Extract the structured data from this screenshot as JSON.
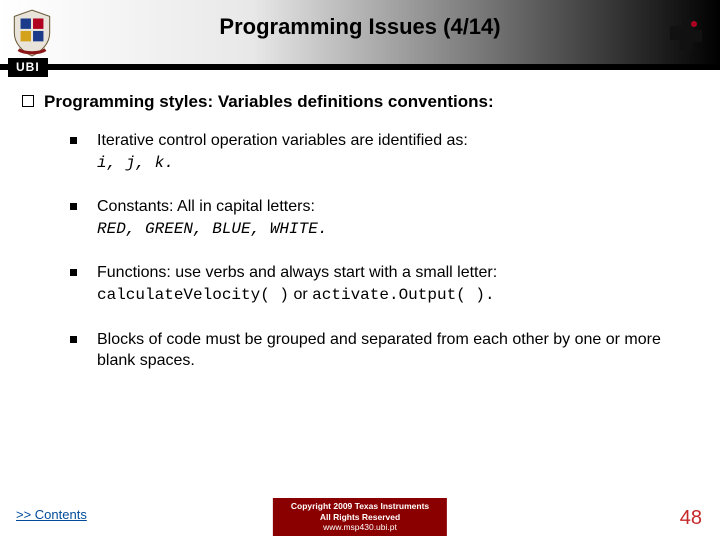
{
  "header": {
    "title": "Programming Issues (4/14)",
    "ubi_tag": "UBI"
  },
  "main": {
    "heading": "Programming styles: Variables definitions conventions:",
    "items": [
      {
        "lead": "Iterative control operation variables are identified as:",
        "mono": "i, j, k."
      },
      {
        "lead": "Constants: All in capital letters:",
        "mono": "RED, GREEN, BLUE, WHITE."
      },
      {
        "lead": "Functions: use verbs and always start with a small letter:",
        "mono_a": "calculateVelocity( )",
        "mid": " or ",
        "mono_b": "activate.Output( )."
      },
      {
        "lead": "Blocks of code must be grouped and separated from each other by one or more blank spaces."
      }
    ]
  },
  "footer": {
    "contents_link": ">> Contents",
    "copyright_line1": "Copyright 2009 Texas Instruments",
    "copyright_line2": "All Rights Reserved",
    "copyright_url": "www.msp430.ubi.pt",
    "page_number": "48"
  }
}
